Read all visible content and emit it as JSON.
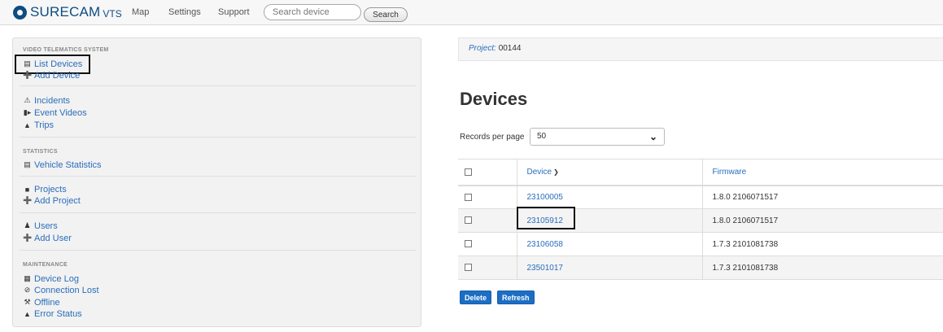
{
  "header": {
    "logo_text": "SURECAM",
    "logo_sub": "VTS",
    "nav": [
      "Map",
      "Settings",
      "Support"
    ],
    "search_placeholder": "Search device",
    "search_button": "Search"
  },
  "sidebar": {
    "section_video": "VIDEO TELEMATICS SYSTEM",
    "list_devices": "List Devices",
    "add_device": "Add Device",
    "incidents": "Incidents",
    "event_videos": "Event Videos",
    "trips": "Trips",
    "section_statistics": "STATISTICS",
    "vehicle_statistics": "Vehicle Statistics",
    "projects": "Projects",
    "add_project": "Add Project",
    "users": "Users",
    "add_user": "Add User",
    "section_maintenance": "MAINTENANCE",
    "device_log": "Device Log",
    "connection_lost": "Connection Lost",
    "offline": "Offline",
    "error_status": "Error Status"
  },
  "project": {
    "label": "Project:",
    "value": "00144"
  },
  "main": {
    "title": "Devices",
    "records_per_page_label": "Records per page",
    "records_per_page_value": "50"
  },
  "table": {
    "headers": {
      "device": "Device",
      "firmware": "Firmware"
    },
    "rows": [
      {
        "device": "23100005",
        "firmware": "1.8.0 2106071517"
      },
      {
        "device": "23105912",
        "firmware": "1.8.0 2106071517"
      },
      {
        "device": "23106058",
        "firmware": "1.7.3 2101081738"
      },
      {
        "device": "23501017",
        "firmware": "1.7.3 2101081738"
      }
    ]
  },
  "actions": {
    "delete": "Delete",
    "refresh": "Refresh"
  },
  "colors": {
    "accent": "#2a6ebb",
    "brand": "#0f4c81",
    "button": "#1c6ec5"
  }
}
